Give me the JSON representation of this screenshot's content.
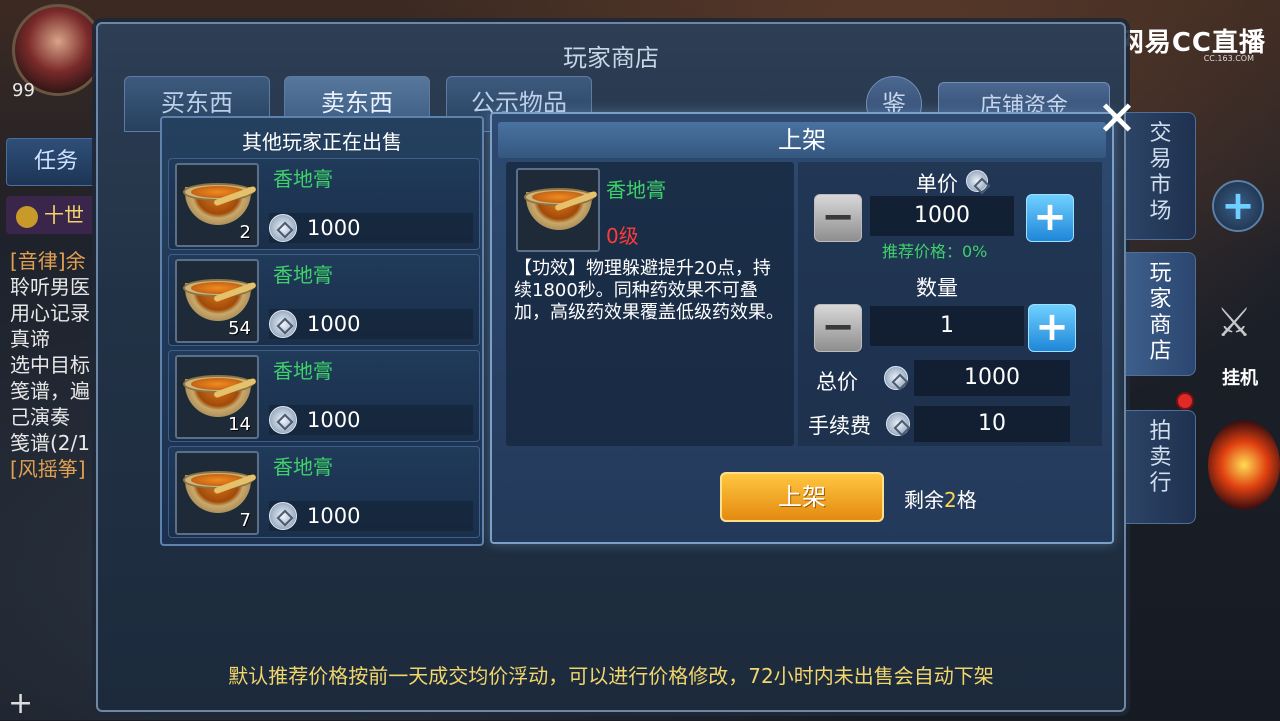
{
  "hud": {
    "player_level": "99",
    "task_tab": "任务",
    "gold_label": "十世",
    "quest_lines": [
      "[音律]余",
      "聆听男医",
      "用心记录",
      "真谛",
      "选中目标",
      "笺谱，遍",
      "己演奏",
      "笺谱(2/1",
      "[风摇筝]"
    ],
    "guaji_label": "挂机",
    "watermark": "网易CC直播",
    "watermark_sub": "CC.163.COM"
  },
  "shop": {
    "title": "玩家商店",
    "tabs": [
      "买东西",
      "卖东西",
      "公示物品"
    ],
    "active_tab_index": 1,
    "appraise_label": "鉴",
    "funds_label": "店铺资金",
    "side_tabs": [
      "交易市场",
      "玩家商店",
      "拍卖行"
    ],
    "active_side_tab_index": 1,
    "footer_tip": "默认推荐价格按前一天成交均价浮动，可以进行价格修改，72小时内未出售会自动下架"
  },
  "others_selling": {
    "title": "其他玩家正在出售",
    "items": [
      {
        "name": "香地膏",
        "qty": "2",
        "price": "1000"
      },
      {
        "name": "香地膏",
        "qty": "54",
        "price": "1000"
      },
      {
        "name": "香地膏",
        "qty": "14",
        "price": "1000"
      },
      {
        "name": "香地膏",
        "qty": "7",
        "price": "1000"
      }
    ]
  },
  "listing": {
    "title": "上架",
    "item_name": "香地膏",
    "item_level": "0级",
    "description": "【功效】物理躲避提升20点，持续1800秒。同种药效果不可叠加，高级药效果覆盖低级药效果。",
    "unit_price_label": "单价",
    "unit_price": "1000",
    "recommend_text": "推荐价格：0%",
    "quantity_label": "数量",
    "quantity": "1",
    "total_label": "总价",
    "total": "1000",
    "fee_label": "手续费",
    "fee": "10",
    "submit_label": "上架",
    "remain_prefix": "剩余",
    "remain_count": "2",
    "remain_suffix": "格",
    "close_symbol": "✕"
  },
  "colors": {
    "item_name_green": "#3ed16a",
    "level_red": "#ff3a3a",
    "tip_yellow": "#f2d66b",
    "button_orange": "#f0a020"
  }
}
